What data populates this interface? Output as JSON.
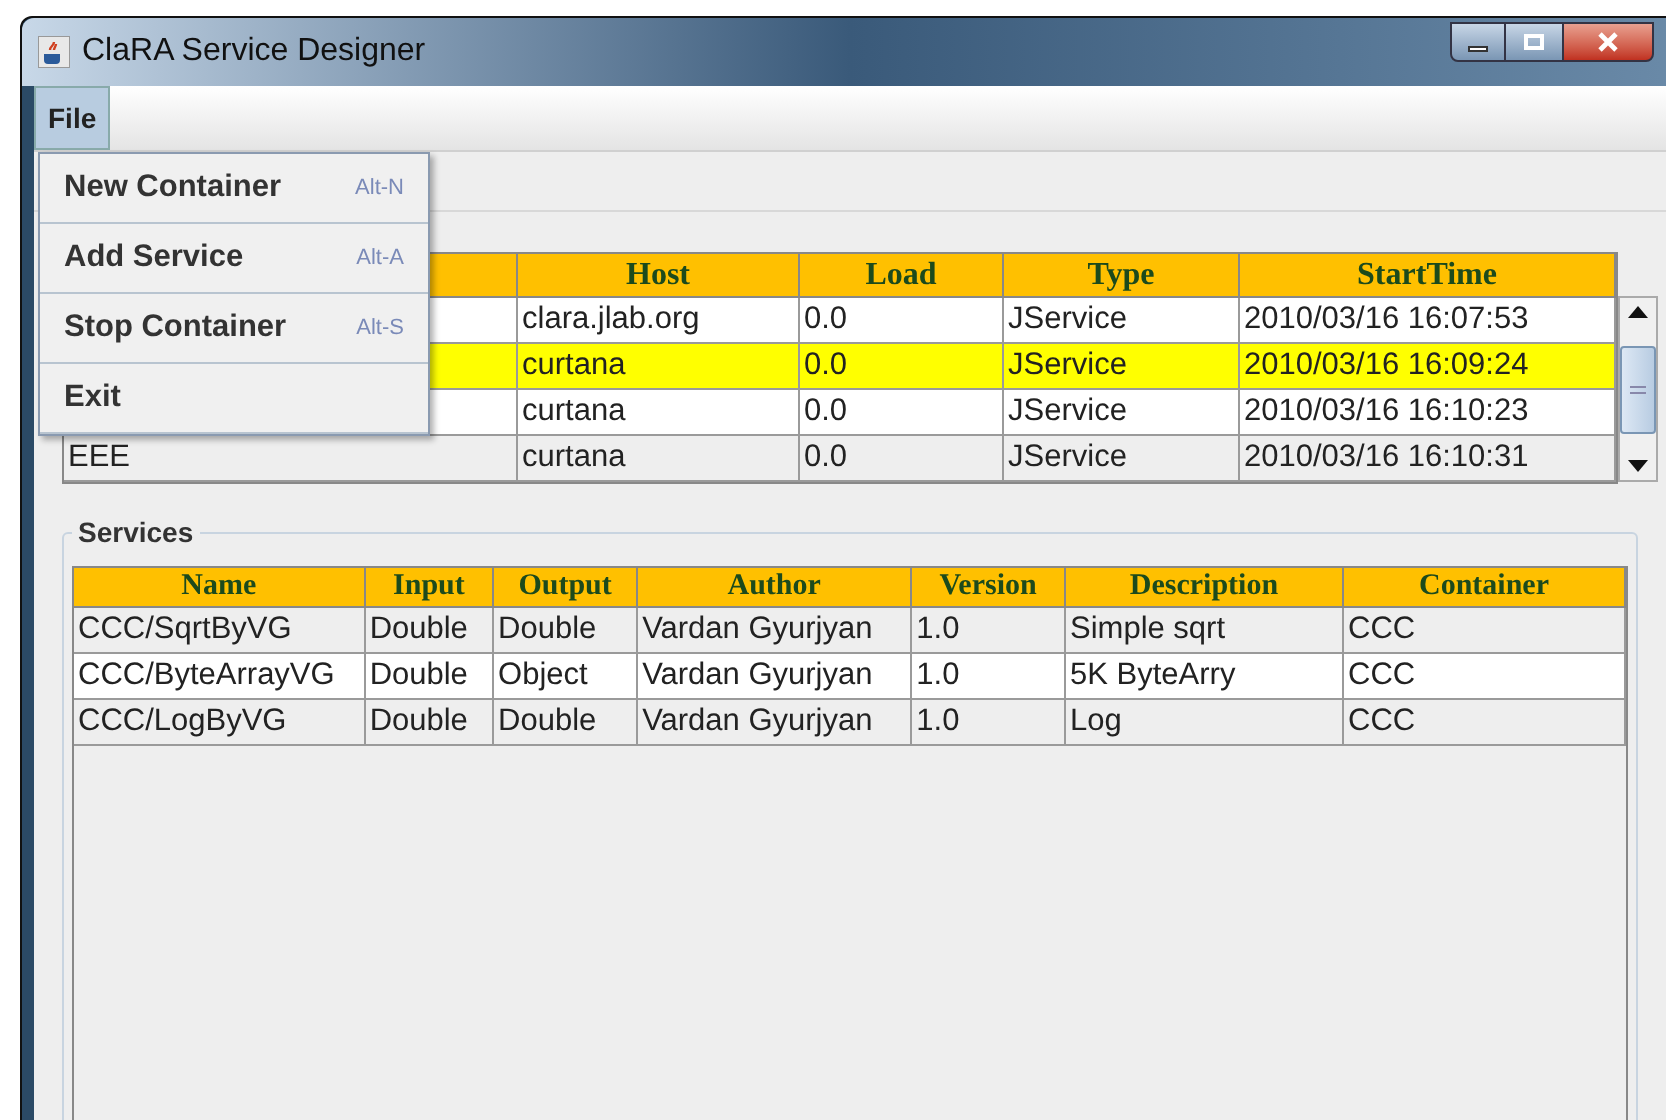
{
  "window": {
    "title": "ClaRA Service Designer"
  },
  "menu_bar": [
    {
      "label": "File",
      "selected": true
    }
  ],
  "file_menu": [
    {
      "label": "New Container",
      "shortcut": "Alt-N"
    },
    {
      "label": "Add Service",
      "shortcut": "Alt-A"
    },
    {
      "label": "Stop Container",
      "shortcut": "Alt-S"
    },
    {
      "label": "Exit"
    }
  ],
  "containers_table": {
    "columns": [
      "",
      "Host",
      "Load",
      "Type",
      "StartTime"
    ],
    "rows": [
      {
        "cells": [
          "",
          "clara.jlab.org",
          "0.0",
          "JService",
          "2010/03/16 16:07:53"
        ],
        "selected": false
      },
      {
        "cells": [
          "",
          "curtana",
          "0.0",
          "JService",
          "2010/03/16 16:09:24"
        ],
        "selected": true
      },
      {
        "cells": [
          "",
          "curtana",
          "0.0",
          "JService",
          "2010/03/16 16:10:23"
        ],
        "selected": false
      },
      {
        "cells": [
          "EEE",
          "curtana",
          "0.0",
          "JService",
          "2010/03/16 16:10:31"
        ],
        "selected": false
      }
    ]
  },
  "services": {
    "title": "Services",
    "columns": [
      "Name",
      "Input",
      "Output",
      "Author",
      "Version",
      "Description",
      "Container"
    ],
    "rows": [
      {
        "cells": [
          "CCC/SqrtByVG",
          "Double",
          "Double",
          "Vardan Gyurjyan",
          "1.0",
          "Simple sqrt",
          "CCC"
        ],
        "selected": false
      },
      {
        "cells": [
          "CCC/ByteArrayVG",
          "Double",
          "Object",
          "Vardan Gyurjyan",
          "1.0",
          "5K ByteArry",
          "CCC"
        ],
        "selected": false
      },
      {
        "cells": [
          "CCC/LogByVG",
          "Double",
          "Double",
          "Vardan Gyurjyan",
          "1.0",
          "Log",
          "CCC"
        ],
        "selected": false
      }
    ]
  }
}
